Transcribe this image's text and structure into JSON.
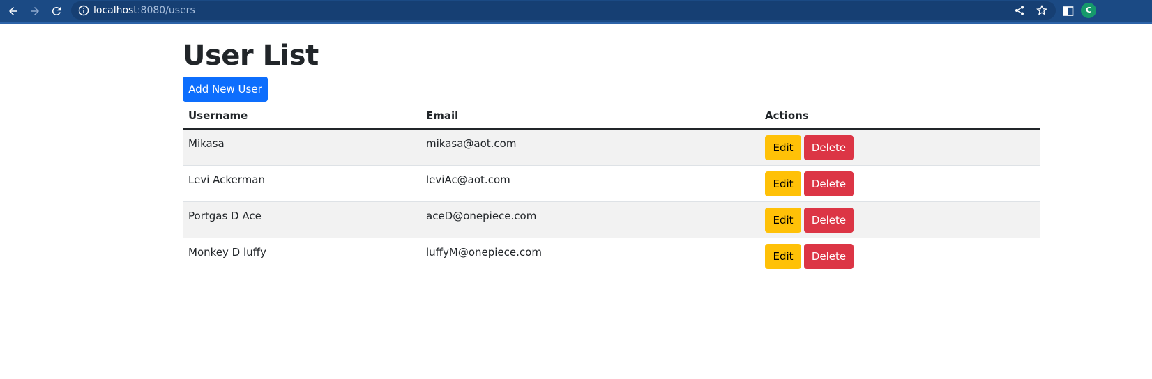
{
  "browser": {
    "url_host": "localhost",
    "url_path": ":8080/users",
    "profile_initial": "C"
  },
  "page": {
    "title": "User List",
    "add_button_label": "Add New User"
  },
  "table": {
    "headers": {
      "username": "Username",
      "email": "Email",
      "actions": "Actions"
    },
    "rows": [
      {
        "username": "Mikasa",
        "email": "mikasa@aot.com",
        "edit_label": "Edit",
        "delete_label": "Delete"
      },
      {
        "username": "Levi Ackerman",
        "email": "leviAc@aot.com",
        "edit_label": "Edit",
        "delete_label": "Delete"
      },
      {
        "username": "Portgas D Ace",
        "email": "aceD@onepiece.com",
        "edit_label": "Edit",
        "delete_label": "Delete"
      },
      {
        "username": "Monkey D luffy",
        "email": "luffyM@onepiece.com",
        "edit_label": "Edit",
        "delete_label": "Delete"
      }
    ]
  },
  "colors": {
    "toolbar": "#1b4a84",
    "primary": "#0d6efd",
    "warning": "#ffc107",
    "danger": "#dc3545",
    "stripe": "#f2f2f2"
  },
  "icons": [
    "back-arrow-icon",
    "forward-arrow-icon",
    "reload-icon",
    "info-icon",
    "share-icon",
    "star-icon",
    "side-panel-icon"
  ]
}
